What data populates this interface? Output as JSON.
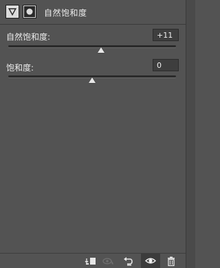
{
  "header": {
    "title": "自然饱和度",
    "icons": [
      "adjustment-triangle-icon",
      "layer-mask-icon"
    ]
  },
  "vibrance": {
    "label": "自然饱和度:",
    "value": "+11",
    "slider_fraction": 0.555
  },
  "saturation": {
    "label": "饱和度:",
    "value": "0",
    "slider_fraction": 0.5
  },
  "footer": {
    "icons": [
      "clip-to-layer-icon",
      "view-previous-icon",
      "reset-icon",
      "visibility-eye-icon",
      "delete-trash-icon"
    ]
  }
}
